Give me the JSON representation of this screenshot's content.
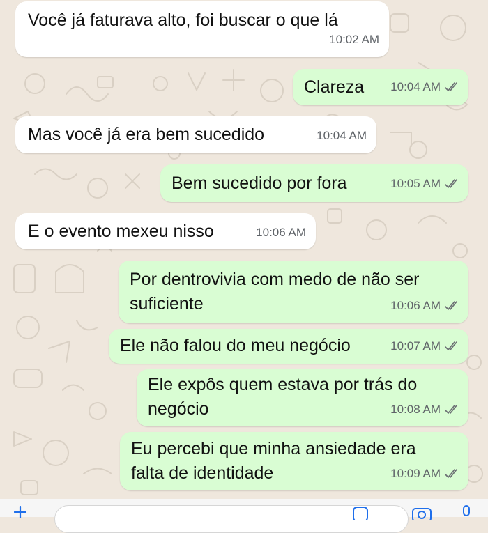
{
  "chat": {
    "messages": [
      {
        "direction": "incoming",
        "text": "Você já faturava alto, foi buscar o que lá",
        "time": "10:02 AM"
      },
      {
        "direction": "outgoing",
        "text": "Clareza",
        "time": "10:04 AM",
        "status": "read"
      },
      {
        "direction": "incoming",
        "text": "Mas você já era bem sucedido",
        "time": "10:04 AM"
      },
      {
        "direction": "outgoing",
        "text": "Bem sucedido por fora",
        "time": "10:05 AM",
        "status": "read"
      },
      {
        "direction": "incoming",
        "text": "E o evento mexeu nisso",
        "time": "10:06 AM"
      },
      {
        "direction": "outgoing",
        "text_lines": [
          "Por dentrovivia com medo de não ser",
          "suficiente"
        ],
        "time": "10:06 AM",
        "status": "read"
      },
      {
        "direction": "outgoing",
        "text": "Ele não falou do meu negócio",
        "time": "10:07 AM",
        "status": "read"
      },
      {
        "direction": "outgoing",
        "text_lines": [
          "Ele expôs quem estava por trás do",
          "negócio"
        ],
        "time": "10:08 AM",
        "status": "read"
      },
      {
        "direction": "outgoing",
        "text_lines": [
          "Eu percebi que minha ansiedade era",
          "falta de identidade"
        ],
        "time": "10:09 AM",
        "status": "read"
      }
    ]
  },
  "colors": {
    "incoming_bubble": "#ffffff",
    "outgoing_bubble": "#d9fdd3",
    "wallpaper": "#efe7dd",
    "timestamp": "#5f6368"
  },
  "icons": {
    "read_receipt": "double-check-icon",
    "composer": [
      "plus-icon",
      "sticker-icon",
      "camera-icon",
      "mic-icon"
    ]
  }
}
